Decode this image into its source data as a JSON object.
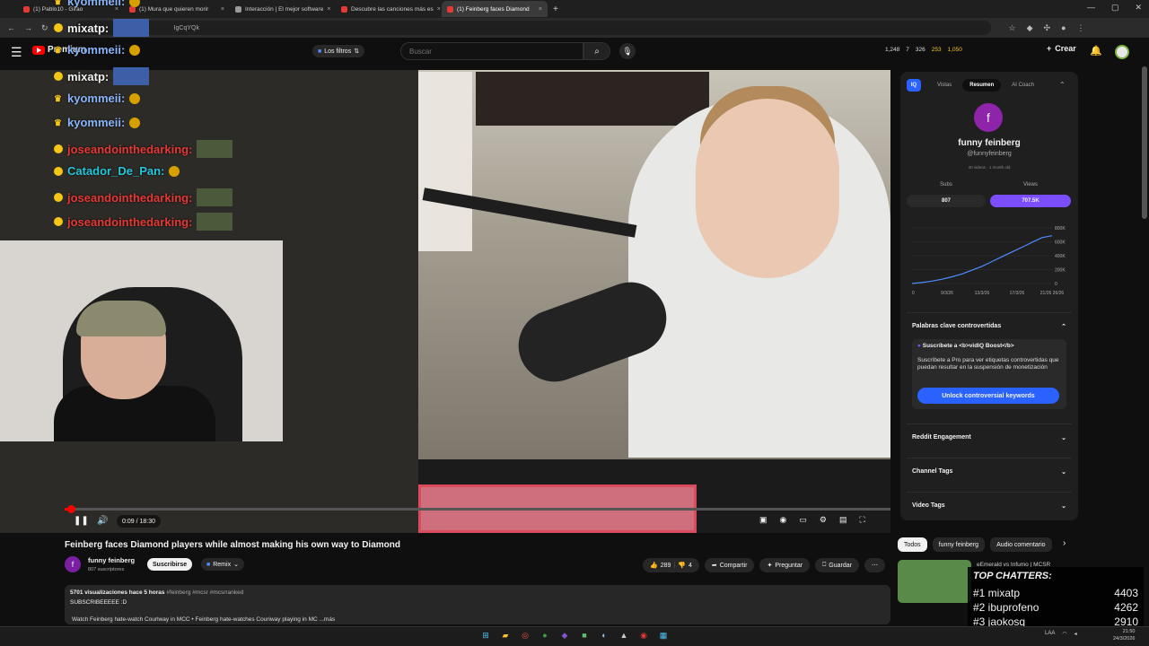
{
  "browser": {
    "tabs": [
      {
        "label": "(1) Pablo10 - Girao"
      },
      {
        "label": "(1) Mura que quieren morir"
      },
      {
        "label": "Interacción | El mejor software"
      },
      {
        "label": "Descubre las canciones más es"
      },
      {
        "label": "(1) Feinberg faces Diamond"
      }
    ],
    "new_tab": "+",
    "url": "IgCqYQk"
  },
  "header": {
    "menu_icon": "☰",
    "logo_text": "Premium",
    "filters_label": "Los filtros",
    "search_placeholder": "Buscar",
    "stats": [
      "1,248",
      "7",
      "326",
      "253",
      "1,050"
    ],
    "create_label": "Crear"
  },
  "chat_overlay": [
    {
      "user": "kyommeii:",
      "color": "#8ab4f8",
      "badge": "crown",
      "attach": "emote"
    },
    {
      "user": "mixatp:",
      "color": "#f1f1f1",
      "badge": "dot",
      "attach": "img2"
    },
    {
      "user": "kyommeii:",
      "color": "#8ab4f8",
      "badge": "crown",
      "attach": "emote"
    },
    {
      "user": "mixatp:",
      "color": "#f1f1f1",
      "badge": "dot",
      "attach": "img2"
    },
    {
      "user": "kyommeii:",
      "color": "#8ab4f8",
      "badge": "crown",
      "attach": "emote"
    },
    {
      "user": "kyommeii:",
      "color": "#8ab4f8",
      "badge": "crown",
      "attach": "emote"
    },
    {
      "user": "joseandointhedarking:",
      "color": "#e53935",
      "badge": "dot",
      "attach": "img"
    },
    {
      "user": "Catador_De_Pan:",
      "color": "#26c6da",
      "badge": "dot",
      "attach": "emote"
    },
    {
      "user": "joseandointhedarking:",
      "color": "#e53935",
      "badge": "dot",
      "attach": "img"
    },
    {
      "user": "joseandointhedarking:",
      "color": "#e53935",
      "badge": "dot",
      "attach": "img"
    }
  ],
  "player": {
    "time": "0:09 / 18:30",
    "progress_fraction": 0.008
  },
  "video": {
    "title": "Feinberg faces Diamond players while almost making his own way to Diamond",
    "channel": "funny feinberg",
    "subs": "807 suscriptores",
    "subscribe_label": "Suscribirse",
    "remix_label": "Remix",
    "likes": "289",
    "dislikes": "4",
    "share_label": "Compartir",
    "ask_label": "Preguntar",
    "save_label": "Guardar",
    "views_meta": "5701 visualizaciones  hace 5 horas",
    "hashtags": "#feinberg #mcsr #mcsrranked",
    "desc_text": "SUBSCRIBEEEEE :D",
    "desc_links": "Watch Feinberg hate-watch Courlway in MCC  •  Feinberg hate-watches Couriway playing in MC  ...más"
  },
  "panel": {
    "tabs": [
      "Vistas",
      "Resumen",
      "AI Coach"
    ],
    "avatar_letter": "f",
    "name": "funny feinberg",
    "handle": "@funnyfeinberg",
    "meta": "40 videos · 1 month old",
    "subs_label": "Subs",
    "views_label": "Views",
    "subs_value": "807",
    "views_value": "707.5K",
    "chart_y_ticks": [
      "800K",
      "600K",
      "400K",
      "200K",
      "0"
    ],
    "chart_x_ticks": [
      "0",
      "9/3/26",
      "13/3/26",
      "17/3/26",
      "21/26 26/26"
    ],
    "chart_line": [
      0,
      2,
      5,
      9,
      14,
      20,
      28,
      36,
      46,
      56,
      66,
      76,
      86,
      96,
      100
    ],
    "keywords_title": "Palabras clave controvertidas",
    "keywords_box_title": "Suscríbete a <b>vidIQ Boost</b>",
    "keywords_box_text": "Suscríbete a Pro para ver etiquetas controvertidas que puedan resultar en la suspensión de monetización",
    "unlock_label": "Unlock controversial keywords",
    "sections": [
      "Reddit Engagement",
      "Channel Tags",
      "Video Tags"
    ]
  },
  "recs": {
    "chips": [
      "Todos",
      "funny feinberg",
      "Audio comentario"
    ],
    "first_title": "eEmerald vs Infumo | MCSR"
  },
  "top_chatters": {
    "title": "TOP CHATTERS:",
    "rows": [
      {
        "rank": "#1 mixatp",
        "count": "4403"
      },
      {
        "rank": "#2 ibuprofeno",
        "count": "4262"
      },
      {
        "rank": "#3 jaokosq",
        "count": "2910"
      }
    ]
  },
  "taskbar": {
    "clock_time": "21:50",
    "clock_date": "24/3/2026",
    "lang": "LAA"
  }
}
